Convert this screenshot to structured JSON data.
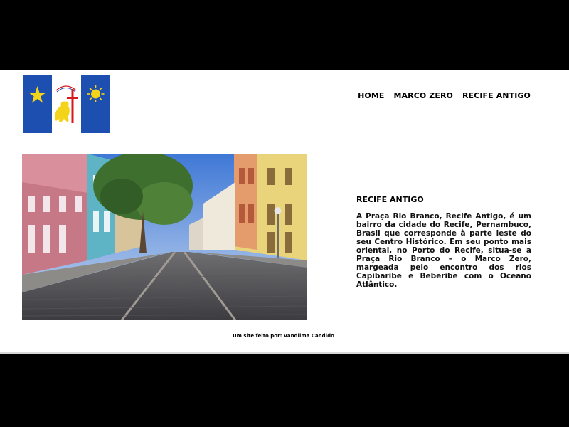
{
  "header": {
    "logo_icon": "recife-flag-icon",
    "nav": [
      {
        "label": "HOME"
      },
      {
        "label": "MARCO ZERO"
      },
      {
        "label": "RECIFE ANTIGO"
      }
    ]
  },
  "main": {
    "image_subject": "cobblestone-street-photo",
    "article": {
      "title": "RECIFE ANTIGO",
      "body": "A Praça Rio Branco, Recife Antigo, é um bairro da cidade do Recife, Pernambuco, Brasil que corresponde à parte leste do seu Centro Histórico. Em seu ponto mais oriental, no Porto do Recife, situa-se a Praça Rio Branco – o Marco Zero, margeada pelo encontro dos rios Capibaribe e Beberibe com o Oceano Atlântico."
    }
  },
  "footer": {
    "credit": "Um site feito por: Vandilma Candido"
  },
  "colors": {
    "flag_blue": "#1d4fb0",
    "flag_yellow": "#f4d41a",
    "flag_red": "#d7191f",
    "page_bg": "#ffffff",
    "backdrop": "#000000"
  }
}
